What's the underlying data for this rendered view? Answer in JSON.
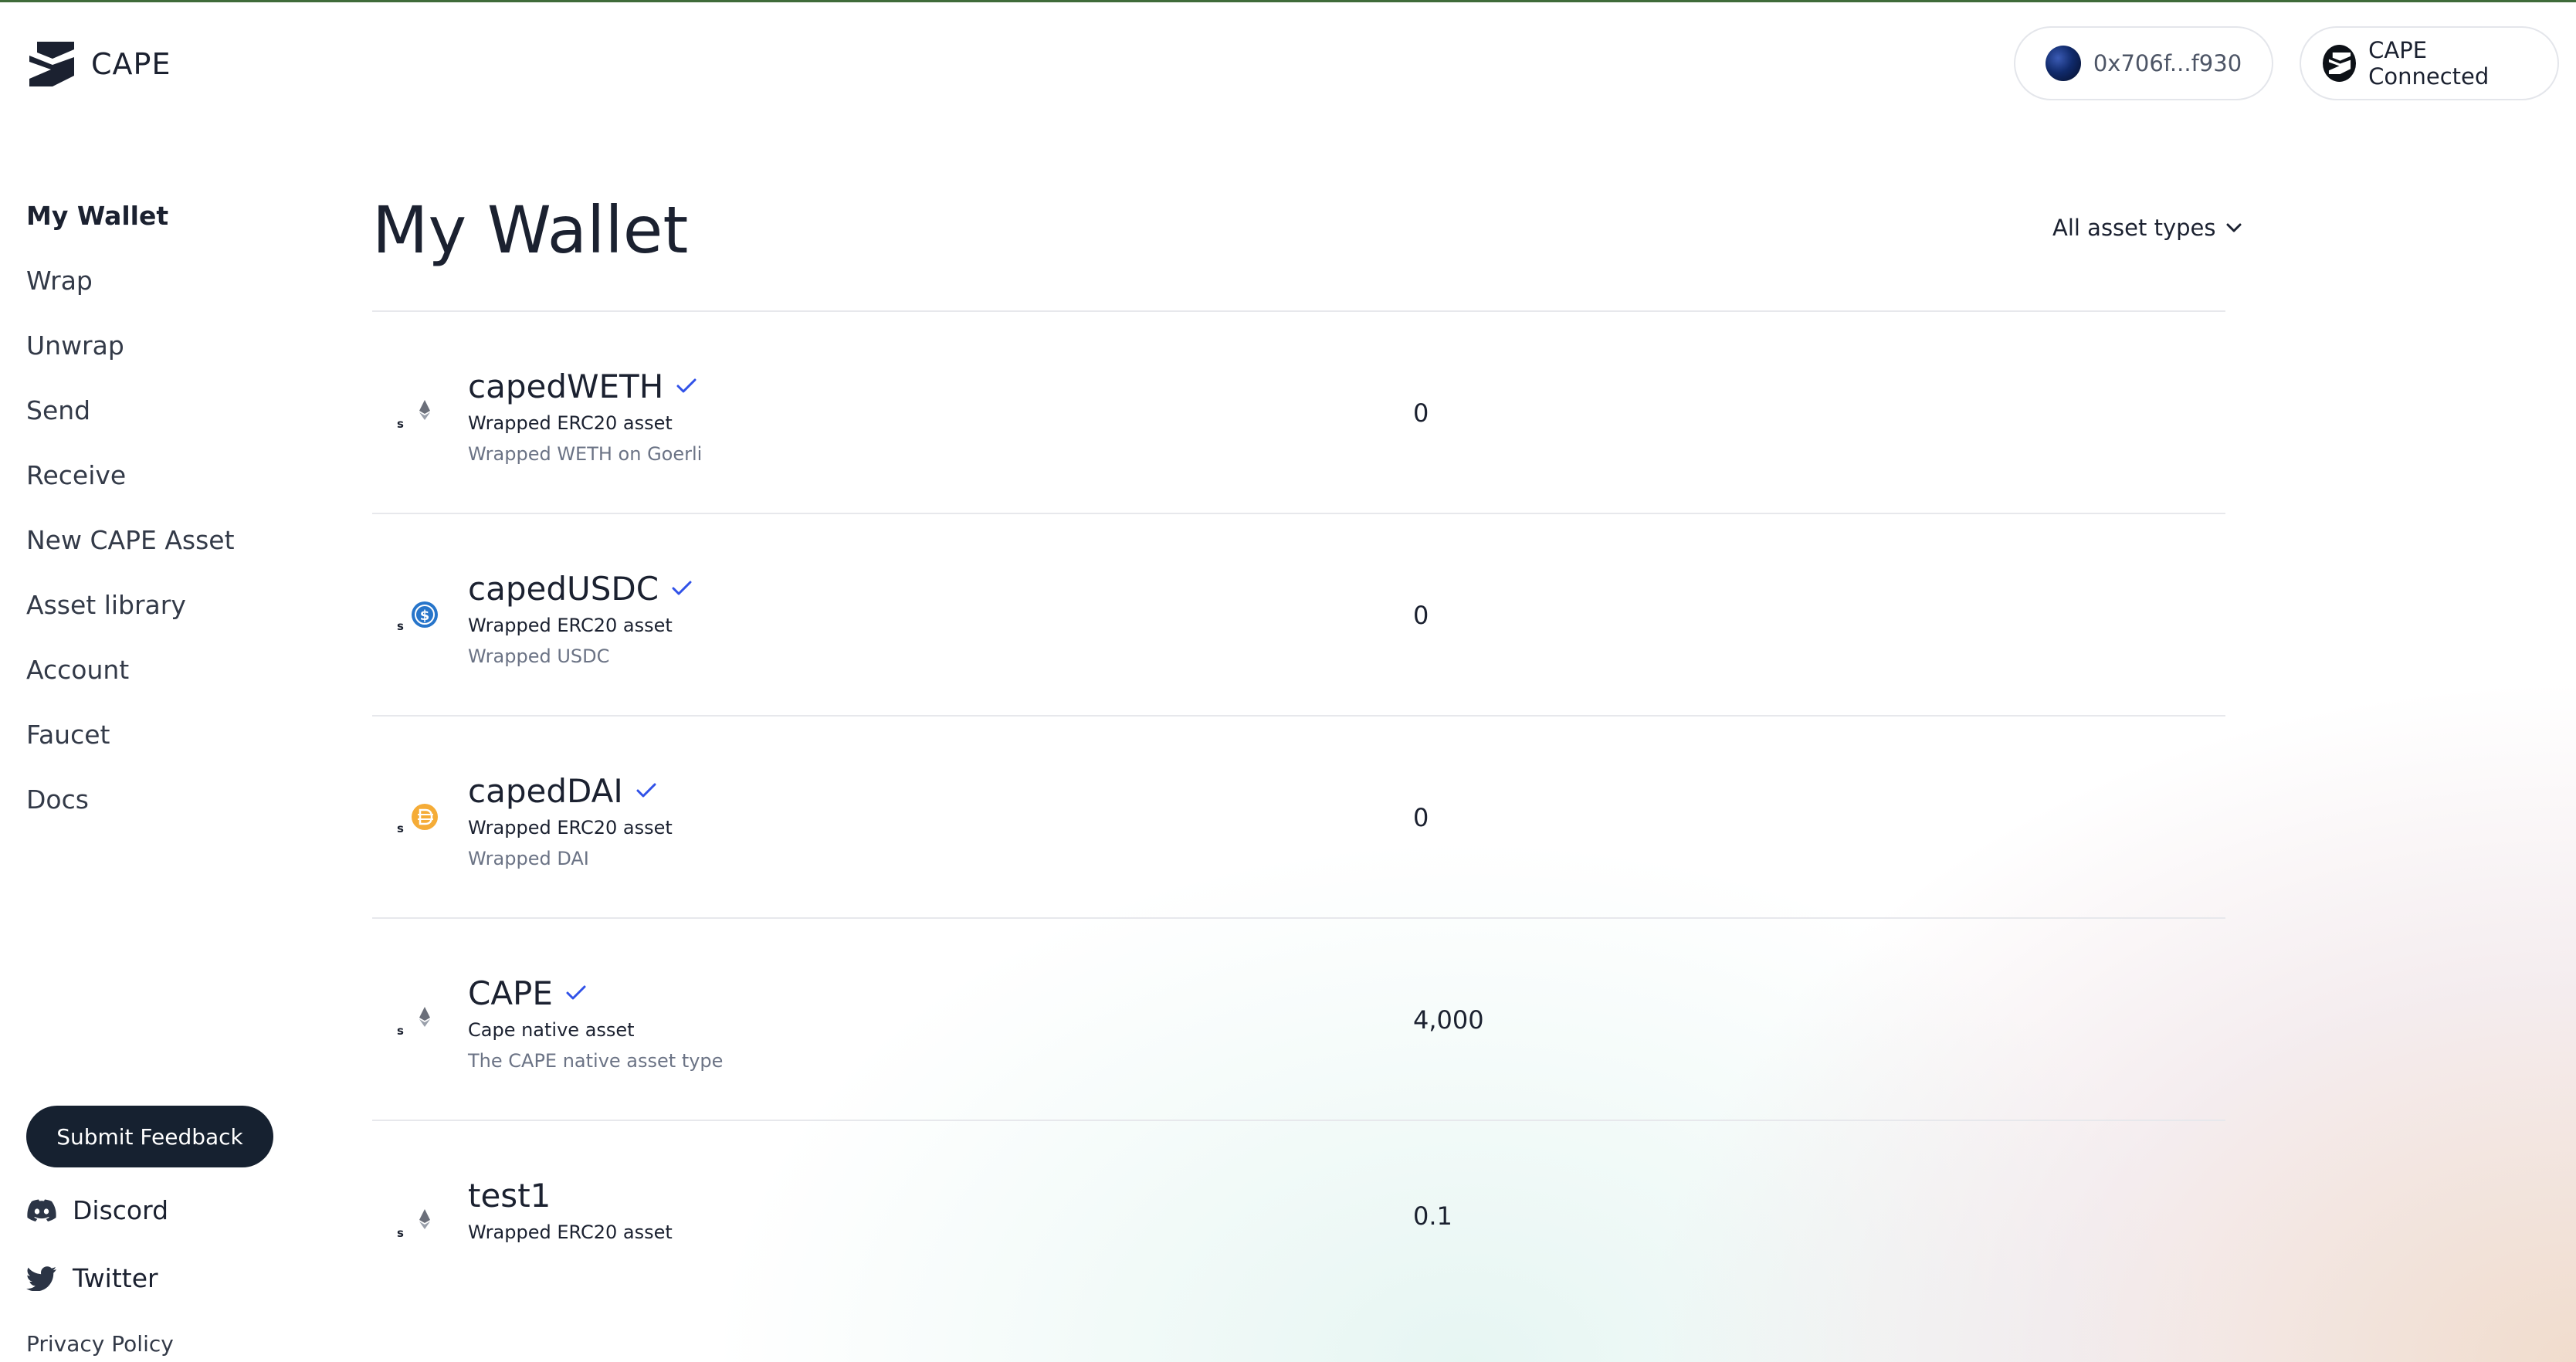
{
  "app": {
    "name": "CAPE"
  },
  "header": {
    "wallet_address": "0x706f...f930",
    "connection_status": "CAPE Connected"
  },
  "sidebar": {
    "items": [
      {
        "label": "My Wallet",
        "active": true
      },
      {
        "label": "Wrap"
      },
      {
        "label": "Unwrap"
      },
      {
        "label": "Send"
      },
      {
        "label": "Receive"
      },
      {
        "label": "New CAPE Asset"
      },
      {
        "label": "Asset library"
      },
      {
        "label": "Account"
      },
      {
        "label": "Faucet"
      },
      {
        "label": "Docs"
      }
    ],
    "feedback_label": "Submit Feedback",
    "discord_label": "Discord",
    "twitter_label": "Twitter",
    "privacy_label": "Privacy Policy"
  },
  "main": {
    "title": "My Wallet",
    "filter_label": "All asset types",
    "assets": [
      {
        "name": "capedWETH",
        "verified": true,
        "type": "Wrapped ERC20 asset",
        "description": "Wrapped WETH on Goerli",
        "balance": "0",
        "icon": "eth-icon"
      },
      {
        "name": "capedUSDC",
        "verified": true,
        "type": "Wrapped ERC20 asset",
        "description": "Wrapped USDC",
        "balance": "0",
        "icon": "usdc-icon"
      },
      {
        "name": "capedDAI",
        "verified": true,
        "type": "Wrapped ERC20 asset",
        "description": "Wrapped DAI",
        "balance": "0",
        "icon": "dai-icon"
      },
      {
        "name": "CAPE",
        "verified": true,
        "type": "Cape native asset",
        "description": "The CAPE native asset type",
        "balance": "4,000",
        "icon": "eth-icon"
      },
      {
        "name": "test1",
        "verified": false,
        "type": "Wrapped ERC20 asset",
        "description": "",
        "balance": "0.1",
        "icon": "eth-icon"
      }
    ]
  },
  "colors": {
    "accent": "#3152e8",
    "dark": "#162130",
    "usdc": "#2775ca",
    "dai": "#f5ac37"
  }
}
